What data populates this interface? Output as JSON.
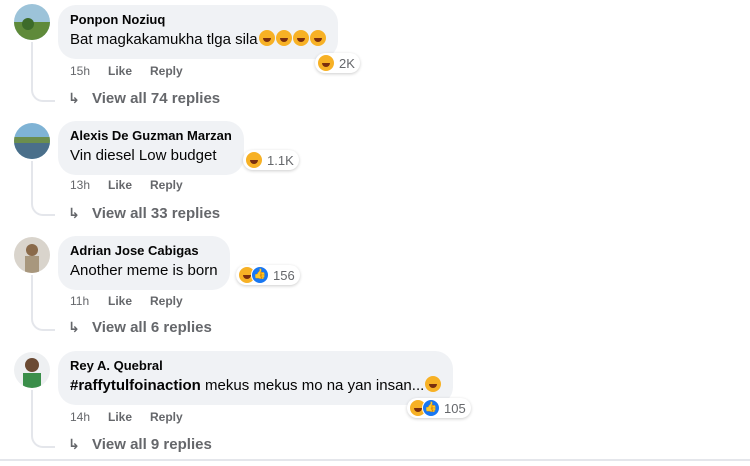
{
  "comments": [
    {
      "author": "Ponpon Noziuq",
      "text": "Bat magkakamukha tlga sila",
      "reaction_count": "2K",
      "time": "15h",
      "like": "Like",
      "reply": "Reply",
      "view_replies": "View all 74 replies"
    },
    {
      "author": "Alexis De Guzman Marzan",
      "text": "Vin diesel Low budget",
      "reaction_count": "1.1K",
      "time": "13h",
      "like": "Like",
      "reply": "Reply",
      "view_replies": "View all 33 replies"
    },
    {
      "author": "Adrian Jose Cabigas",
      "text": "Another meme is born",
      "reaction_count": "156",
      "time": "11h",
      "like": "Like",
      "reply": "Reply",
      "view_replies": "View all 6 replies"
    },
    {
      "author": "Rey A. Quebral",
      "hashtag": "#raffytulfoinaction",
      "text": " mekus mekus mo na yan insan...",
      "reaction_count": "105",
      "time": "14h",
      "like": "Like",
      "reply": "Reply",
      "view_replies": "View all 9 replies"
    }
  ],
  "colors": {
    "bubble": "#f0f2f5",
    "secondary_text": "#65676b",
    "like_blue": "#1877f2",
    "haha_yellow": "#f7b125"
  },
  "icons": {
    "reply_arrow": "reply-arrow-icon",
    "haha": "haha-reaction-icon",
    "like": "like-reaction-icon"
  }
}
